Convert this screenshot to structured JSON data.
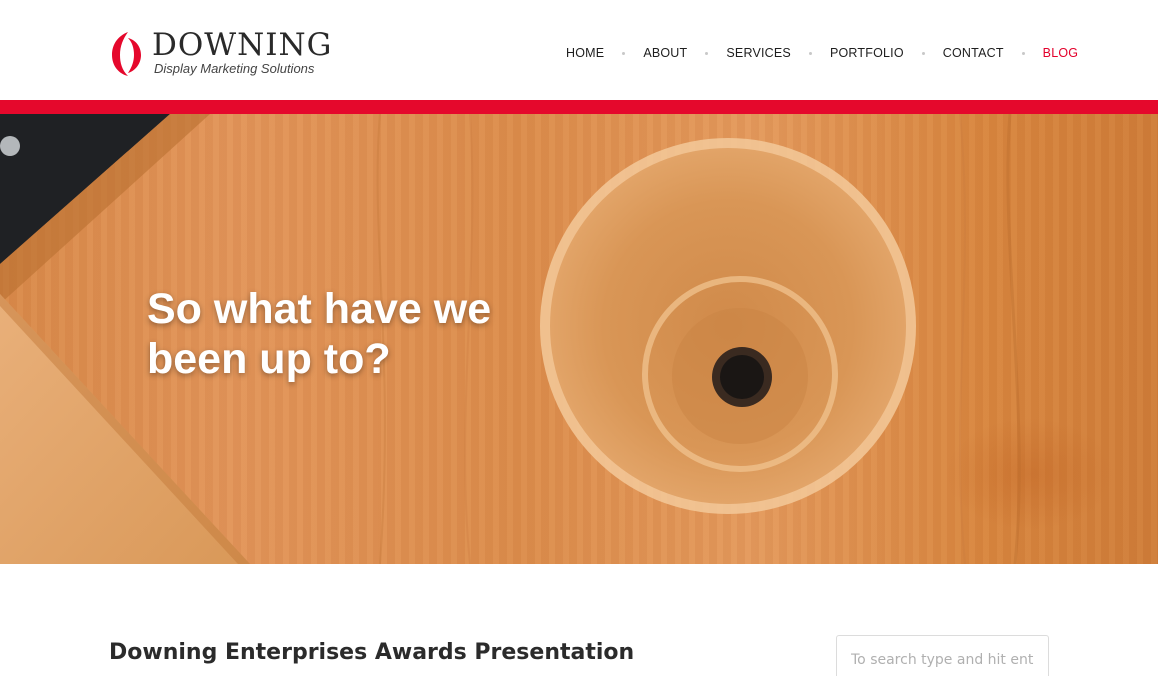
{
  "brand": {
    "name": "DOWNING",
    "tagline": "Display Marketing Solutions",
    "accent_color": "#e5082c"
  },
  "nav": {
    "items": [
      {
        "label": "HOME",
        "active": false
      },
      {
        "label": "ABOUT",
        "active": false
      },
      {
        "label": "SERVICES",
        "active": false
      },
      {
        "label": "PORTFOLIO",
        "active": false
      },
      {
        "label": "CONTACT",
        "active": false
      },
      {
        "label": "BLOG",
        "active": true
      }
    ]
  },
  "hero": {
    "title": "So what have we been up to?"
  },
  "post": {
    "title": "Downing Enterprises Awards Presentation"
  },
  "search": {
    "placeholder": "To search type and hit enter"
  }
}
